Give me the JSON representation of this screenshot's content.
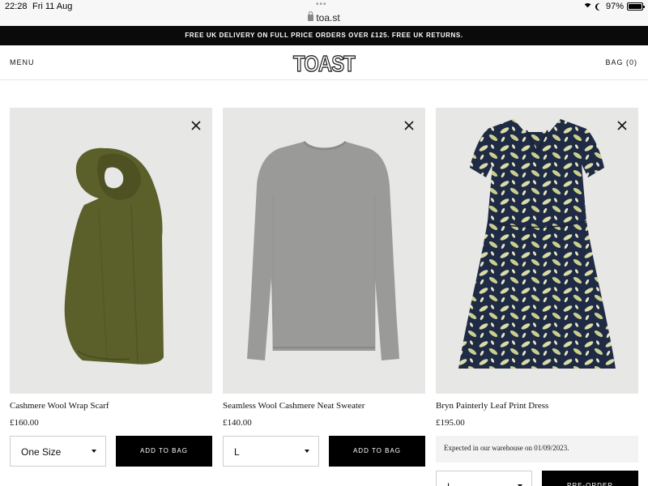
{
  "status_bar": {
    "time": "22:28",
    "date": "Fri 11 Aug",
    "url": "toa.st",
    "battery": "97%",
    "battery_level": 0.97
  },
  "promo_banner": {
    "text": "FREE UK DELIVERY ON FULL PRICE ORDERS OVER £125. FREE UK RETURNS."
  },
  "header": {
    "menu_label": "MENU",
    "logo_text": "TOAST",
    "bag_label": "BAG (0)"
  },
  "products": [
    {
      "name": "Cashmere Wool Wrap Scarf",
      "price": "£160.00",
      "size": "One Size",
      "button_label": "ADD TO BAG",
      "image_icon": "scarf-image",
      "color": "#5b5f2a"
    },
    {
      "name": "Seamless Wool Cashmere Neat Sweater",
      "price": "£140.00",
      "size": "L",
      "button_label": "ADD TO BAG",
      "image_icon": "sweater-image",
      "color": "#9a9a98"
    },
    {
      "name": "Bryn Painterly Leaf Print Dress",
      "price": "£195.00",
      "notice": "Expected in our warehouse on 01/09/2023.",
      "size": "L",
      "button_label": "PRE-ORDER",
      "image_icon": "dress-image",
      "color": "#1f2a44"
    }
  ],
  "colors": {
    "banner_bg": "#0a0a0a",
    "button_bg": "#000000",
    "image_bg": "#e7e7e6"
  }
}
